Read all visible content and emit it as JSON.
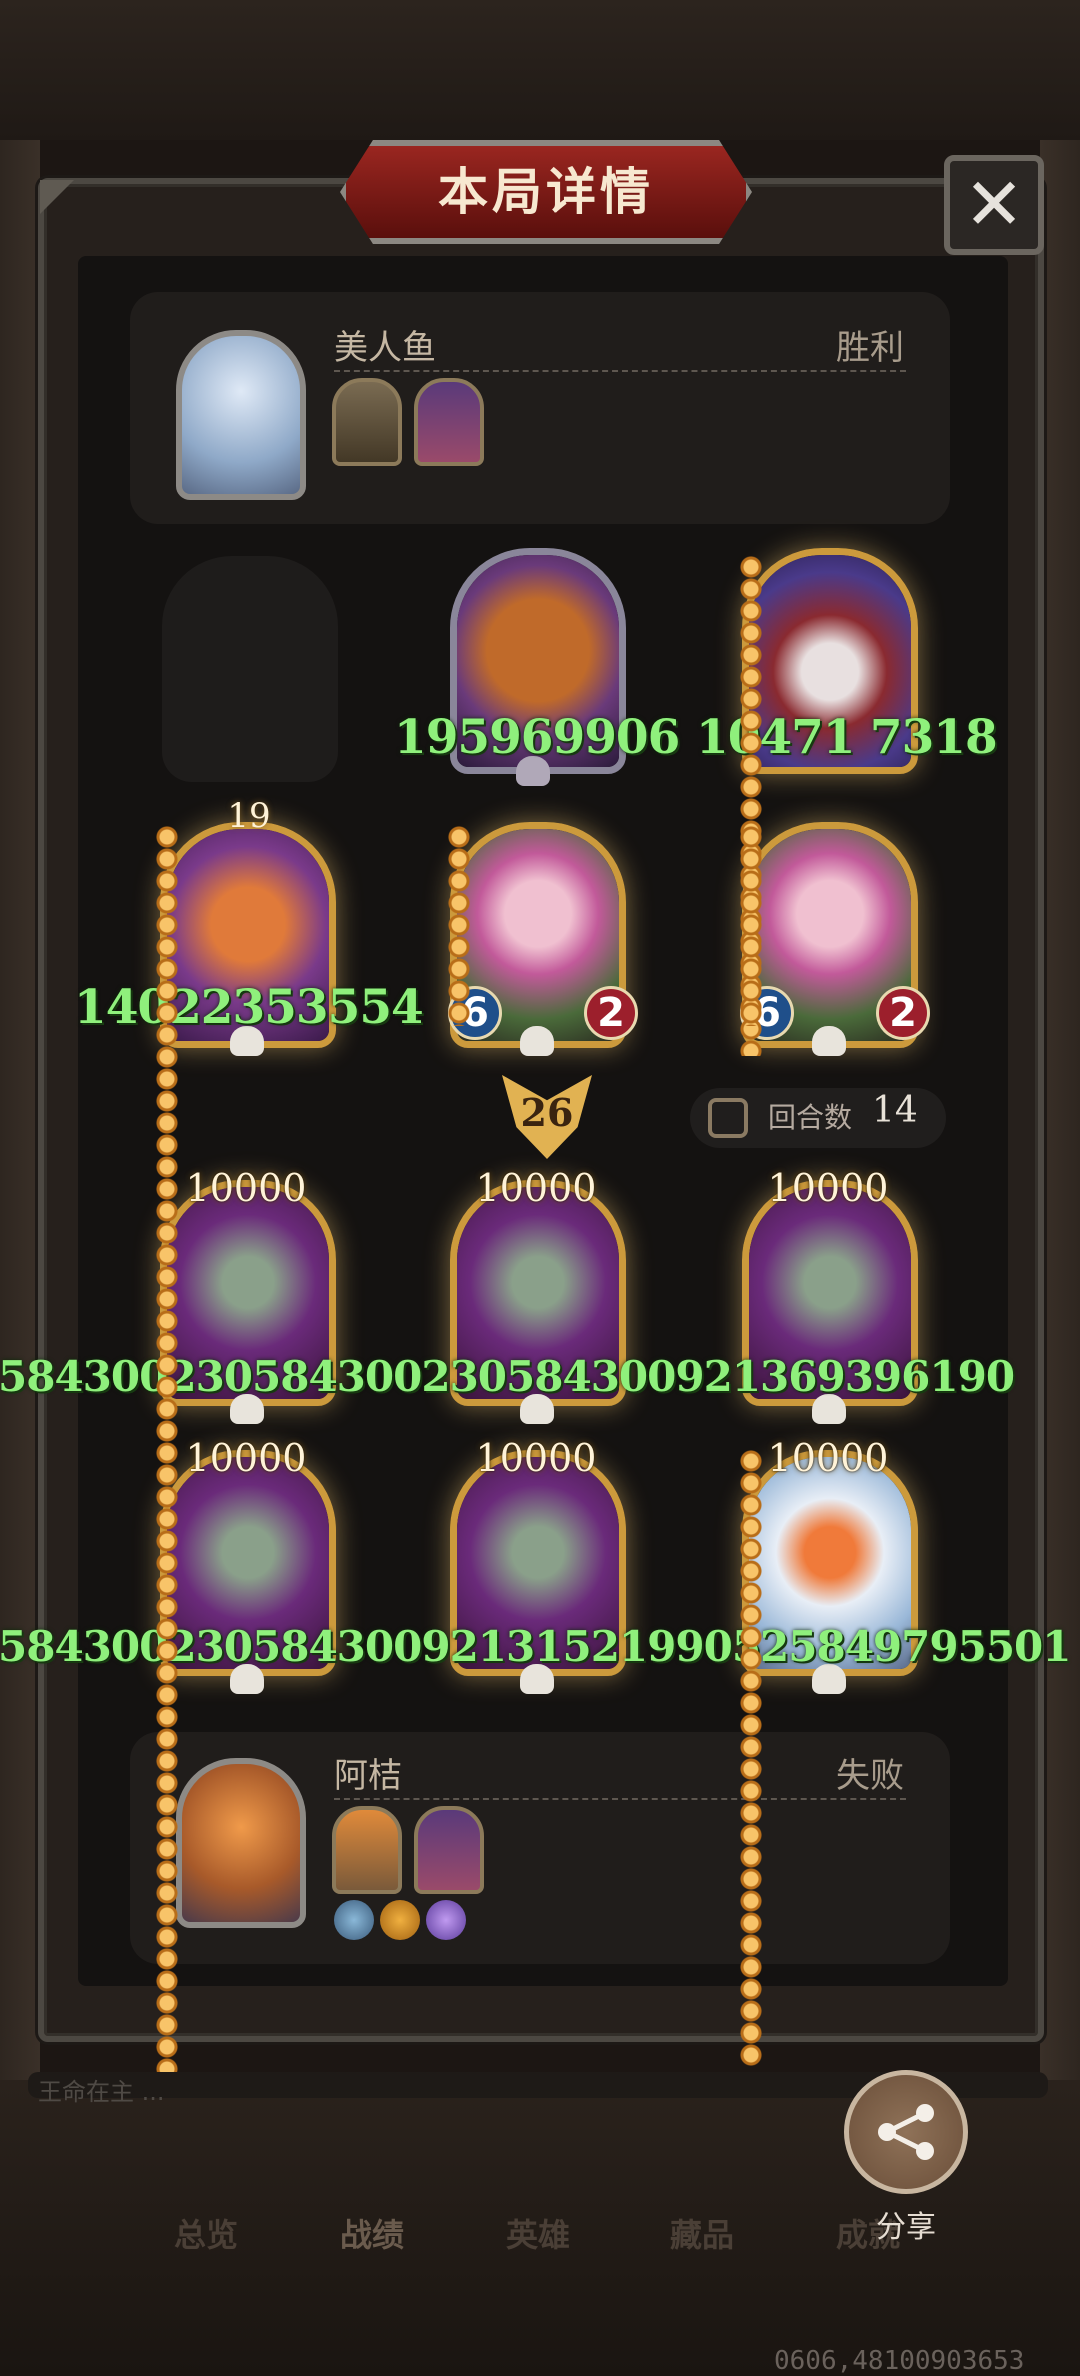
{
  "title": "本局详情",
  "close_label": "✕",
  "top_player": {
    "name": "美人鱼",
    "result": "胜利"
  },
  "bottom_player": {
    "name": "阿桔",
    "result": "失败"
  },
  "enemy_row1": [
    {
      "overlay": "195969906"
    },
    {
      "overlay": "10471 7318"
    }
  ],
  "enemy_row2": [
    {
      "level": "19",
      "overlay": "14022353554"
    },
    {
      "atk": "6",
      "hp": "2"
    },
    {
      "atk": "6",
      "hp": "2"
    }
  ],
  "tier": "26",
  "round_label": "回合数",
  "round_value": "14",
  "friendly_value": "10000",
  "friendly_row1_overlay": "584300230584300230584300921369396190",
  "friendly_row2_overlay": "58430023058430092131521990525849795501",
  "chat_text": "王命在主 ...",
  "nav": [
    "总览",
    "战绩",
    "英雄",
    "藏品",
    "成就"
  ],
  "share_label": "分享",
  "coord_text": "0606,48100903653",
  "colors": {
    "overlay_green": "#8ff07c",
    "gold_frame": "#cc9a3c",
    "title_red": "#9a2620"
  },
  "icons": [
    "close-icon",
    "share-icon",
    "skull-icon",
    "anchor-icon",
    "refresh-icon"
  ]
}
